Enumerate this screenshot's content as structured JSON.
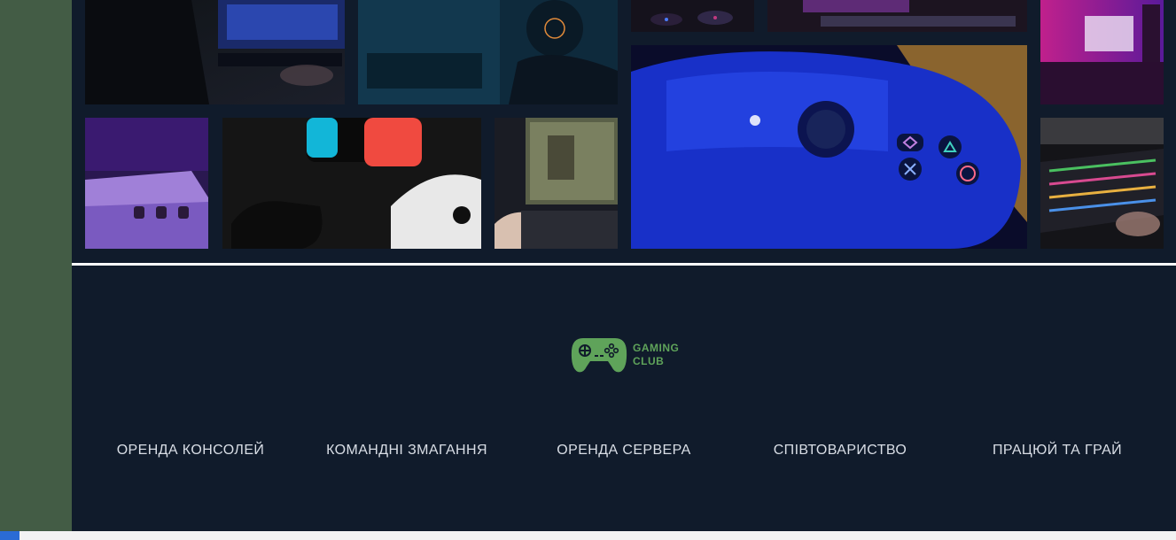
{
  "gallery": {
    "images": [
      {
        "name": "gamer-at-monitor-photo"
      },
      {
        "name": "gamer-with-headset-photo"
      },
      {
        "name": "gaming-mice-photo"
      },
      {
        "name": "keyboard-glow-photo"
      },
      {
        "name": "neon-room-photo"
      },
      {
        "name": "sega-dreamcast-photo"
      },
      {
        "name": "nintendo-switch-controllers-photo"
      },
      {
        "name": "laptop-game-photo"
      },
      {
        "name": "playstation-controller-photo"
      },
      {
        "name": "rgb-keyboard-photo"
      }
    ]
  },
  "footer": {
    "logo": {
      "line1": "GAMING",
      "line2": "CLUB",
      "color": "#5fa35a"
    },
    "nav": [
      {
        "label": "ОРЕНДА КОНСОЛЕЙ"
      },
      {
        "label": "КОМАНДНІ ЗМАГАННЯ"
      },
      {
        "label": "ОРЕНДА СЕРВЕРА"
      },
      {
        "label": "СПІВТОВАРИСТВО"
      },
      {
        "label": "ПРАЦЮЙ ТА ГРАЙ"
      }
    ]
  },
  "colors": {
    "sidebar": "#435c45",
    "background": "#101b2b",
    "accent": "#5fa35a"
  }
}
